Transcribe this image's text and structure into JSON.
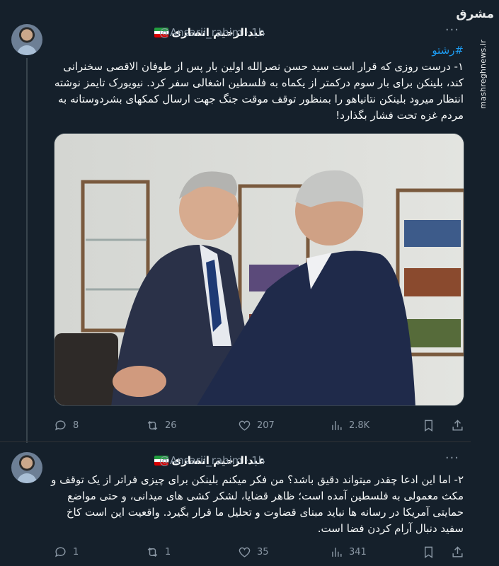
{
  "watermark": {
    "logo_text": "مشرق",
    "url": "mashreghnews.ir"
  },
  "colors": {
    "background": "#15202b",
    "accent": "#1d9bf0",
    "muted": "#8b98a5",
    "flag_green": "#239f40",
    "flag_white": "#ffffff",
    "flag_red": "#da0000"
  },
  "tweets": [
    {
      "author_name": "عبدالرحیم انصاری",
      "handle": "@Ansarii_rahim",
      "separator": "·",
      "time": "1h",
      "hashtag": "#رشتو",
      "text": "۱- درست روزی که قرار است سید حسن نصرالله اولین بار پس از طوفان الاقصی سخنرانی کند، بلینکن برای بار سوم درکمتر از یکماه به فلسطین اشغالی سفر کرد. نیویورک تایمز نوشته انتظار میرود بلینکن نتانیاهو را بمنظور توقف موقت جنگ جهت ارسال کمکهای بشردوستانه به مردم غزه تحت فشار بگذارد!",
      "stats": {
        "replies": "8",
        "retweets": "26",
        "likes": "207",
        "views": "2.8K"
      }
    },
    {
      "author_name": "عبدالرحیم انصاری",
      "handle": "@Ansarii_rahim",
      "separator": "·",
      "time": "1h",
      "text": "۲- اما این ادعا چقدر میتواند دقیق باشد؟ من فکر میکنم بلینکن برای چیزی فراتر از یک توقف و مکث معمولی به فلسطین آمده است؛ ظاهر قضایا، لشکر کشی های میدانی، و حتی مواضع حمایتی آمریکا در رسانه ها نباید مبنای قضاوت و تحلیل ما قرار بگیرد. واقعیت این است کاخ سفید دنبال آرام کردن فضا است.",
      "stats": {
        "replies": "1",
        "retweets": "1",
        "likes": "35",
        "views": "341"
      }
    }
  ]
}
